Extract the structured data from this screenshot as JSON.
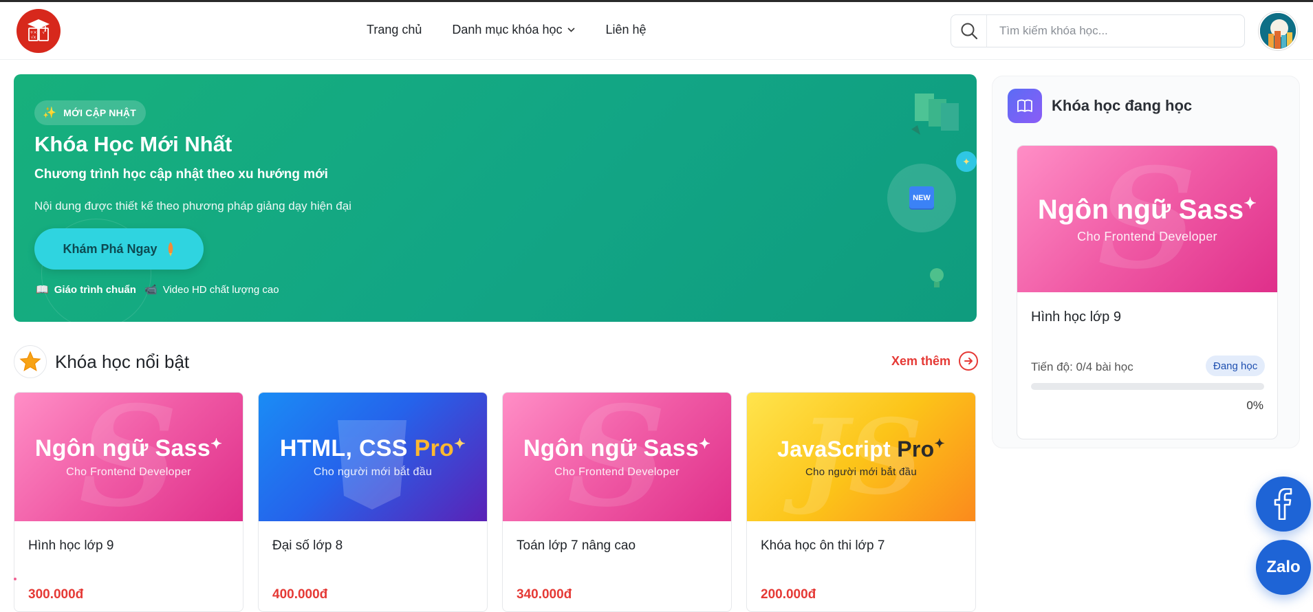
{
  "nav": {
    "home": "Trang chủ",
    "categories": "Danh mục khóa học",
    "contact": "Liên hệ"
  },
  "search": {
    "placeholder": "Tìm kiếm khóa học..."
  },
  "hero": {
    "badge": "MỚI CẬP NHẬT",
    "title": "Khóa Học Mới Nhất",
    "subtitle": "Chương trình học cập nhật theo xu hướng mới",
    "description": "Nội dung được thiết kế theo phương pháp giảng dạy hiện đại",
    "cta": "Khám Phá Ngay",
    "features": [
      "Giáo trình chuẩn",
      "Video HD chất lượng cao"
    ],
    "new_tag": "NEW"
  },
  "featured": {
    "title": "Khóa học nổi bật",
    "see_more": "Xem thêm",
    "courses": [
      {
        "thumb_title": "Ngôn ngữ Sass",
        "thumb_sub": "Cho Frontend Developer",
        "name": "Hình học lớp 9",
        "price": "300.000đ"
      },
      {
        "thumb_title": "HTML, CSS",
        "thumb_title_accent": "Pro",
        "thumb_sub": "Cho người mới bắt đầu",
        "name": "Đại số lớp 8",
        "price": "400.000đ"
      },
      {
        "thumb_title": "Ngôn ngữ Sass",
        "thumb_sub": "Cho Frontend Developer",
        "name": "Toán lớp 7 nâng cao",
        "price": "340.000đ"
      },
      {
        "thumb_title": "JavaScript",
        "thumb_title_accent": "Pro",
        "thumb_sub": "Cho người mới bắt đầu",
        "name": "Khóa học ôn thi lớp 7",
        "price": "200.000đ"
      }
    ]
  },
  "sidebar": {
    "title": "Khóa học đang học",
    "course": {
      "thumb_title": "Ngôn ngữ Sass",
      "thumb_sub": "Cho Frontend Developer",
      "name": "Hình học lớp 9",
      "progress_text": "Tiến độ: 0/4 bài học",
      "status": "Đang học",
      "progress_percent": "0%",
      "progress_value": 0
    }
  },
  "floating": {
    "zalo": "Zalo",
    "facebook_icon": "facebook-icon"
  },
  "colors": {
    "accent_red": "#e53935",
    "hero_green": "#12a585",
    "float_blue": "#1e64d6"
  }
}
